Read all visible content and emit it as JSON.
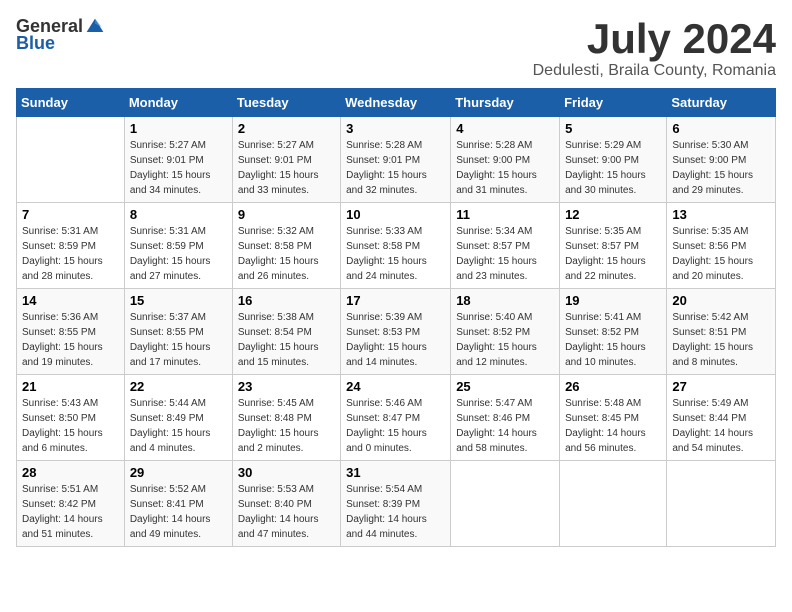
{
  "logo": {
    "general": "General",
    "blue": "Blue"
  },
  "title": "July 2024",
  "subtitle": "Dedulesti, Braila County, Romania",
  "weekdays": [
    "Sunday",
    "Monday",
    "Tuesday",
    "Wednesday",
    "Thursday",
    "Friday",
    "Saturday"
  ],
  "weeks": [
    [
      {
        "day": "",
        "sunrise": "",
        "sunset": "",
        "daylight": ""
      },
      {
        "day": "1",
        "sunrise": "Sunrise: 5:27 AM",
        "sunset": "Sunset: 9:01 PM",
        "daylight": "Daylight: 15 hours and 34 minutes."
      },
      {
        "day": "2",
        "sunrise": "Sunrise: 5:27 AM",
        "sunset": "Sunset: 9:01 PM",
        "daylight": "Daylight: 15 hours and 33 minutes."
      },
      {
        "day": "3",
        "sunrise": "Sunrise: 5:28 AM",
        "sunset": "Sunset: 9:01 PM",
        "daylight": "Daylight: 15 hours and 32 minutes."
      },
      {
        "day": "4",
        "sunrise": "Sunrise: 5:28 AM",
        "sunset": "Sunset: 9:00 PM",
        "daylight": "Daylight: 15 hours and 31 minutes."
      },
      {
        "day": "5",
        "sunrise": "Sunrise: 5:29 AM",
        "sunset": "Sunset: 9:00 PM",
        "daylight": "Daylight: 15 hours and 30 minutes."
      },
      {
        "day": "6",
        "sunrise": "Sunrise: 5:30 AM",
        "sunset": "Sunset: 9:00 PM",
        "daylight": "Daylight: 15 hours and 29 minutes."
      }
    ],
    [
      {
        "day": "7",
        "sunrise": "Sunrise: 5:31 AM",
        "sunset": "Sunset: 8:59 PM",
        "daylight": "Daylight: 15 hours and 28 minutes."
      },
      {
        "day": "8",
        "sunrise": "Sunrise: 5:31 AM",
        "sunset": "Sunset: 8:59 PM",
        "daylight": "Daylight: 15 hours and 27 minutes."
      },
      {
        "day": "9",
        "sunrise": "Sunrise: 5:32 AM",
        "sunset": "Sunset: 8:58 PM",
        "daylight": "Daylight: 15 hours and 26 minutes."
      },
      {
        "day": "10",
        "sunrise": "Sunrise: 5:33 AM",
        "sunset": "Sunset: 8:58 PM",
        "daylight": "Daylight: 15 hours and 24 minutes."
      },
      {
        "day": "11",
        "sunrise": "Sunrise: 5:34 AM",
        "sunset": "Sunset: 8:57 PM",
        "daylight": "Daylight: 15 hours and 23 minutes."
      },
      {
        "day": "12",
        "sunrise": "Sunrise: 5:35 AM",
        "sunset": "Sunset: 8:57 PM",
        "daylight": "Daylight: 15 hours and 22 minutes."
      },
      {
        "day": "13",
        "sunrise": "Sunrise: 5:35 AM",
        "sunset": "Sunset: 8:56 PM",
        "daylight": "Daylight: 15 hours and 20 minutes."
      }
    ],
    [
      {
        "day": "14",
        "sunrise": "Sunrise: 5:36 AM",
        "sunset": "Sunset: 8:55 PM",
        "daylight": "Daylight: 15 hours and 19 minutes."
      },
      {
        "day": "15",
        "sunrise": "Sunrise: 5:37 AM",
        "sunset": "Sunset: 8:55 PM",
        "daylight": "Daylight: 15 hours and 17 minutes."
      },
      {
        "day": "16",
        "sunrise": "Sunrise: 5:38 AM",
        "sunset": "Sunset: 8:54 PM",
        "daylight": "Daylight: 15 hours and 15 minutes."
      },
      {
        "day": "17",
        "sunrise": "Sunrise: 5:39 AM",
        "sunset": "Sunset: 8:53 PM",
        "daylight": "Daylight: 15 hours and 14 minutes."
      },
      {
        "day": "18",
        "sunrise": "Sunrise: 5:40 AM",
        "sunset": "Sunset: 8:52 PM",
        "daylight": "Daylight: 15 hours and 12 minutes."
      },
      {
        "day": "19",
        "sunrise": "Sunrise: 5:41 AM",
        "sunset": "Sunset: 8:52 PM",
        "daylight": "Daylight: 15 hours and 10 minutes."
      },
      {
        "day": "20",
        "sunrise": "Sunrise: 5:42 AM",
        "sunset": "Sunset: 8:51 PM",
        "daylight": "Daylight: 15 hours and 8 minutes."
      }
    ],
    [
      {
        "day": "21",
        "sunrise": "Sunrise: 5:43 AM",
        "sunset": "Sunset: 8:50 PM",
        "daylight": "Daylight: 15 hours and 6 minutes."
      },
      {
        "day": "22",
        "sunrise": "Sunrise: 5:44 AM",
        "sunset": "Sunset: 8:49 PM",
        "daylight": "Daylight: 15 hours and 4 minutes."
      },
      {
        "day": "23",
        "sunrise": "Sunrise: 5:45 AM",
        "sunset": "Sunset: 8:48 PM",
        "daylight": "Daylight: 15 hours and 2 minutes."
      },
      {
        "day": "24",
        "sunrise": "Sunrise: 5:46 AM",
        "sunset": "Sunset: 8:47 PM",
        "daylight": "Daylight: 15 hours and 0 minutes."
      },
      {
        "day": "25",
        "sunrise": "Sunrise: 5:47 AM",
        "sunset": "Sunset: 8:46 PM",
        "daylight": "Daylight: 14 hours and 58 minutes."
      },
      {
        "day": "26",
        "sunrise": "Sunrise: 5:48 AM",
        "sunset": "Sunset: 8:45 PM",
        "daylight": "Daylight: 14 hours and 56 minutes."
      },
      {
        "day": "27",
        "sunrise": "Sunrise: 5:49 AM",
        "sunset": "Sunset: 8:44 PM",
        "daylight": "Daylight: 14 hours and 54 minutes."
      }
    ],
    [
      {
        "day": "28",
        "sunrise": "Sunrise: 5:51 AM",
        "sunset": "Sunset: 8:42 PM",
        "daylight": "Daylight: 14 hours and 51 minutes."
      },
      {
        "day": "29",
        "sunrise": "Sunrise: 5:52 AM",
        "sunset": "Sunset: 8:41 PM",
        "daylight": "Daylight: 14 hours and 49 minutes."
      },
      {
        "day": "30",
        "sunrise": "Sunrise: 5:53 AM",
        "sunset": "Sunset: 8:40 PM",
        "daylight": "Daylight: 14 hours and 47 minutes."
      },
      {
        "day": "31",
        "sunrise": "Sunrise: 5:54 AM",
        "sunset": "Sunset: 8:39 PM",
        "daylight": "Daylight: 14 hours and 44 minutes."
      },
      {
        "day": "",
        "sunrise": "",
        "sunset": "",
        "daylight": ""
      },
      {
        "day": "",
        "sunrise": "",
        "sunset": "",
        "daylight": ""
      },
      {
        "day": "",
        "sunrise": "",
        "sunset": "",
        "daylight": ""
      }
    ]
  ]
}
